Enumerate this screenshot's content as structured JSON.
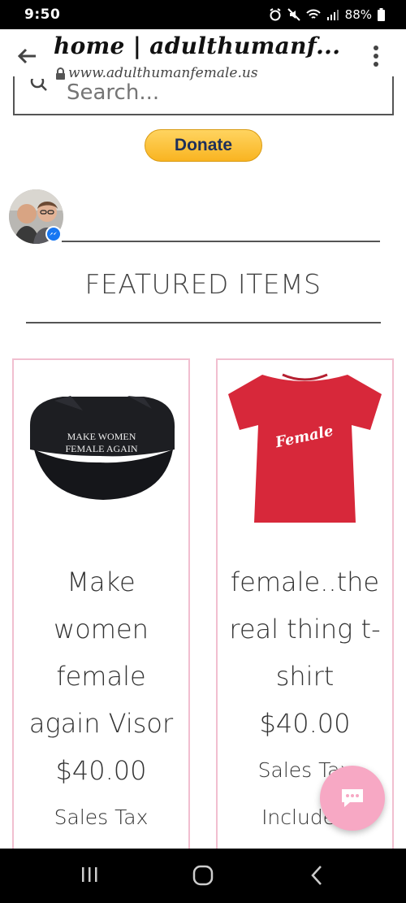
{
  "status_bar": {
    "time": "9:50",
    "battery": "88%"
  },
  "browser": {
    "title": "home | adulthumanf...",
    "url": "www.adulthumanfemale.us"
  },
  "search": {
    "placeholder": "Search..."
  },
  "donate": {
    "label": "Donate"
  },
  "featured": {
    "heading": "FEATURED ITEMS"
  },
  "products": [
    {
      "name": "Make women female again Visor",
      "price": "$40.00",
      "tax": "Sales Tax Included",
      "image_text": "MAKE WOMEN\nFEMALE AGAIN"
    },
    {
      "name": "female..the real thing t-shirt",
      "price": "$40.00",
      "tax": "Sales Tax Included",
      "image_text": "Female"
    }
  ],
  "colors": {
    "accent_pink": "#f7a8c4",
    "card_border": "#f1bfd0",
    "shirt_red": "#d7283a",
    "donate_yellow": "#ffc439"
  }
}
